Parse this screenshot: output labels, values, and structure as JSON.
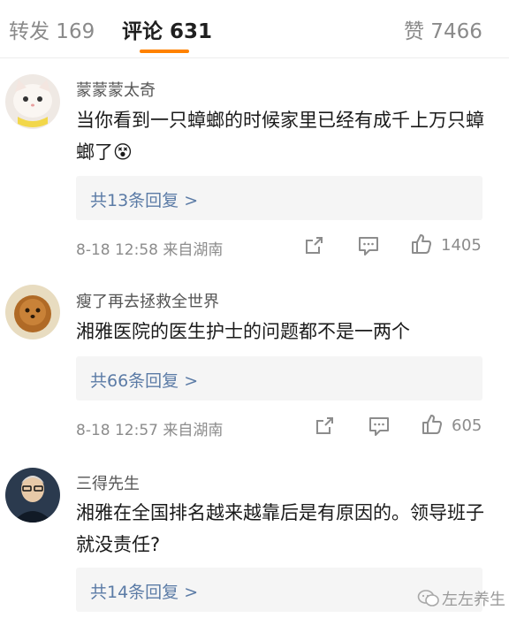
{
  "tabs": {
    "reposts": "转发 169",
    "comments": "评论 631",
    "likes": "赞 7466"
  },
  "comments": [
    {
      "username": "蒙蒙蒙太奇",
      "text": "当你看到一只蟑螂的时候家里已经有成千上万只蟑螂了😵",
      "replies": "共13条回复 >",
      "meta": "8-18 12:58  来自湖南",
      "likes": "1405"
    },
    {
      "username": "瘦了再去拯救全世界",
      "text": "湘雅医院的医生护士的问题都不是一两个",
      "replies": "共66条回复 >",
      "meta": "8-18 12:57  来自湖南",
      "likes": "605"
    },
    {
      "username": "三得先生",
      "text": "湘雅在全国排名越来越靠后是有原因的。领导班子就没责任?",
      "replies": "共14条回复 >"
    }
  ],
  "watermark": "左左养生",
  "colors": {
    "accent": "#ff8200",
    "link": "#5b7ba6",
    "muted": "#8c8c8c"
  }
}
